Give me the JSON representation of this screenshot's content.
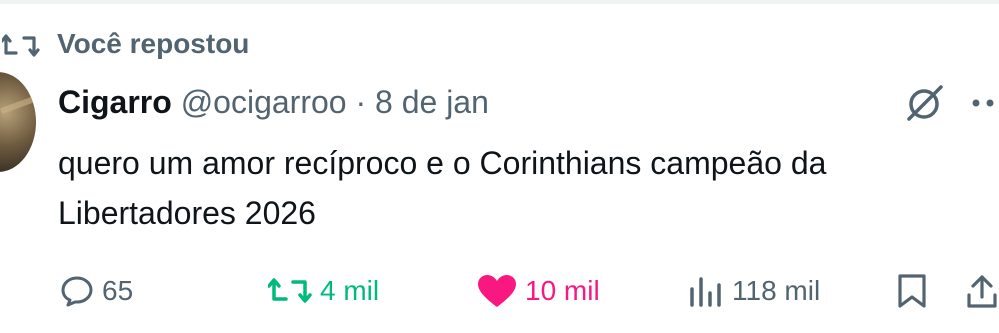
{
  "repost_context": {
    "label": "Você repostou"
  },
  "tweet": {
    "display_name": "Cigarro",
    "handle": "@ocigarroo",
    "separator": "·",
    "date": "8 de jan",
    "text_line1": "quero um amor recíproco e o Corinthians campeão da",
    "text_line2": "Libertadores 2026"
  },
  "actions": {
    "replies": "65",
    "reposts": "4 mil",
    "likes": "10 mil",
    "views": "118 mil"
  },
  "colors": {
    "secondary_text": "#536471",
    "primary_text": "#0f1419",
    "repost_active": "#00ba7c",
    "like_active": "#f91880"
  },
  "icons": {
    "repost_header": "repost-icon",
    "grok": "grok-icon",
    "more": "more-icon",
    "reply": "reply-icon",
    "repost": "repost-icon",
    "like": "heart-icon",
    "views": "views-icon",
    "bookmark": "bookmark-icon",
    "share": "share-icon"
  }
}
